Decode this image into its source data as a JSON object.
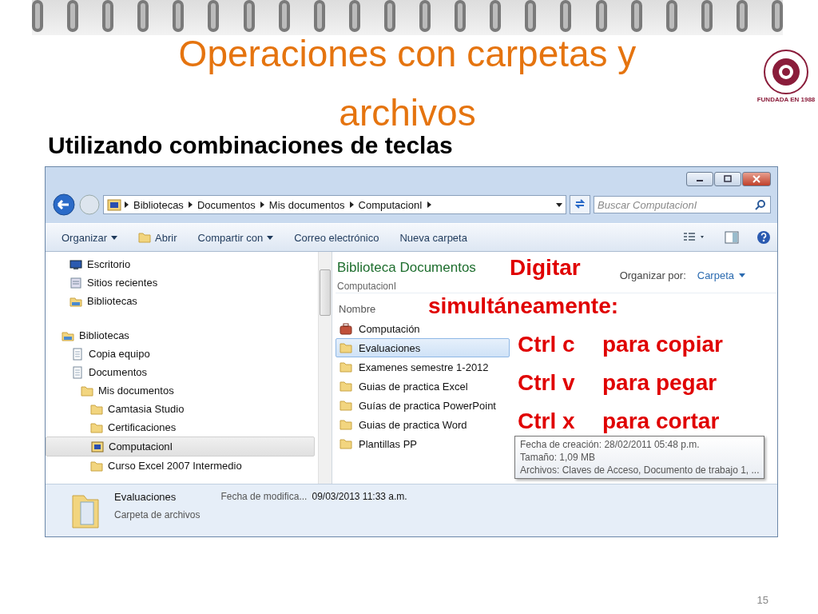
{
  "slide": {
    "title": "Operaciones con carpetas y archivos",
    "subtitle": "Utilizando combinaciones de teclas",
    "page_number": "15",
    "logo_caption": "FUNDADA EN 1988"
  },
  "window": {
    "address": [
      "Bibliotecas",
      "Documentos",
      "Mis documentos",
      "ComputacionI"
    ],
    "search": {
      "placeholder": "Buscar ComputacionI"
    },
    "toolbar": [
      {
        "label": "Organizar",
        "dropdown": true,
        "kind": "text"
      },
      {
        "label": "Abrir",
        "dropdown": false,
        "kind": "folder"
      },
      {
        "label": "Compartir con",
        "dropdown": true,
        "kind": "text"
      },
      {
        "label": "Correo electrónico",
        "dropdown": false,
        "kind": "text"
      },
      {
        "label": "Nueva carpeta",
        "dropdown": false,
        "kind": "text"
      }
    ],
    "nav": [
      {
        "label": "Escritorio",
        "kind": "desktop",
        "selected": false
      },
      {
        "label": "Sitios recientes",
        "kind": "recent",
        "selected": false
      },
      {
        "label": "Bibliotecas",
        "kind": "library",
        "selected": false
      },
      {
        "label": "Bibliotecas",
        "kind": "library",
        "selected": false,
        "children": [
          {
            "label": "Copia equipo",
            "kind": "doc",
            "selected": false
          },
          {
            "label": "Documentos",
            "kind": "doc",
            "selected": false,
            "children": [
              {
                "label": "Mis documentos",
                "kind": "folder",
                "selected": false,
                "children": [
                  {
                    "label": "Camtasia Studio",
                    "kind": "folder",
                    "selected": false
                  },
                  {
                    "label": "Certificaciones",
                    "kind": "folder",
                    "selected": false
                  },
                  {
                    "label": "ComputacionI",
                    "kind": "computer",
                    "selected": true
                  },
                  {
                    "label": "Curso Excel 2007 Intermedio",
                    "kind": "folder",
                    "selected": false
                  }
                ]
              }
            ]
          }
        ]
      }
    ],
    "library": {
      "title": "Biblioteca Documentos",
      "subtitle": "ComputacionI",
      "arrange_label": "Organizar por:",
      "arrange_value": "Carpeta"
    },
    "columns": [
      "Nombre"
    ],
    "files": [
      {
        "name": "Computación",
        "kind": "briefcase",
        "selected": false
      },
      {
        "name": "Evaluaciones",
        "kind": "folder",
        "selected": true
      },
      {
        "name": "Examenes semestre 1-2012",
        "kind": "folder",
        "selected": false
      },
      {
        "name": "Guias de practica Excel",
        "kind": "folder",
        "selected": false
      },
      {
        "name": "Guías de practica PowerPoint",
        "kind": "folder",
        "selected": false
      },
      {
        "name": "Guias de practica Word",
        "kind": "folder",
        "selected": false
      },
      {
        "name": "Plantillas PP",
        "kind": "folder",
        "selected": false
      }
    ],
    "tooltip": [
      "Fecha de creación: 28/02/2011 05:48 p.m.",
      "Tamaño: 1,09 MB",
      "Archivos: Claves de Acceso, Documento de trabajo 1, ..."
    ],
    "details": {
      "name": "Evaluaciones",
      "type": "Carpeta de archivos",
      "label": "Fecha de modifica...",
      "value": "09/03/2013 11:33 a.m."
    }
  },
  "overlay": {
    "heading": [
      "Digitar",
      "simultáneamente:"
    ],
    "shortcuts": [
      {
        "keys": "Ctrl c",
        "action": "para copiar"
      },
      {
        "keys": "Ctrl v",
        "action": "para pegar"
      },
      {
        "keys": "Ctrl x",
        "action": "para cortar"
      }
    ]
  }
}
